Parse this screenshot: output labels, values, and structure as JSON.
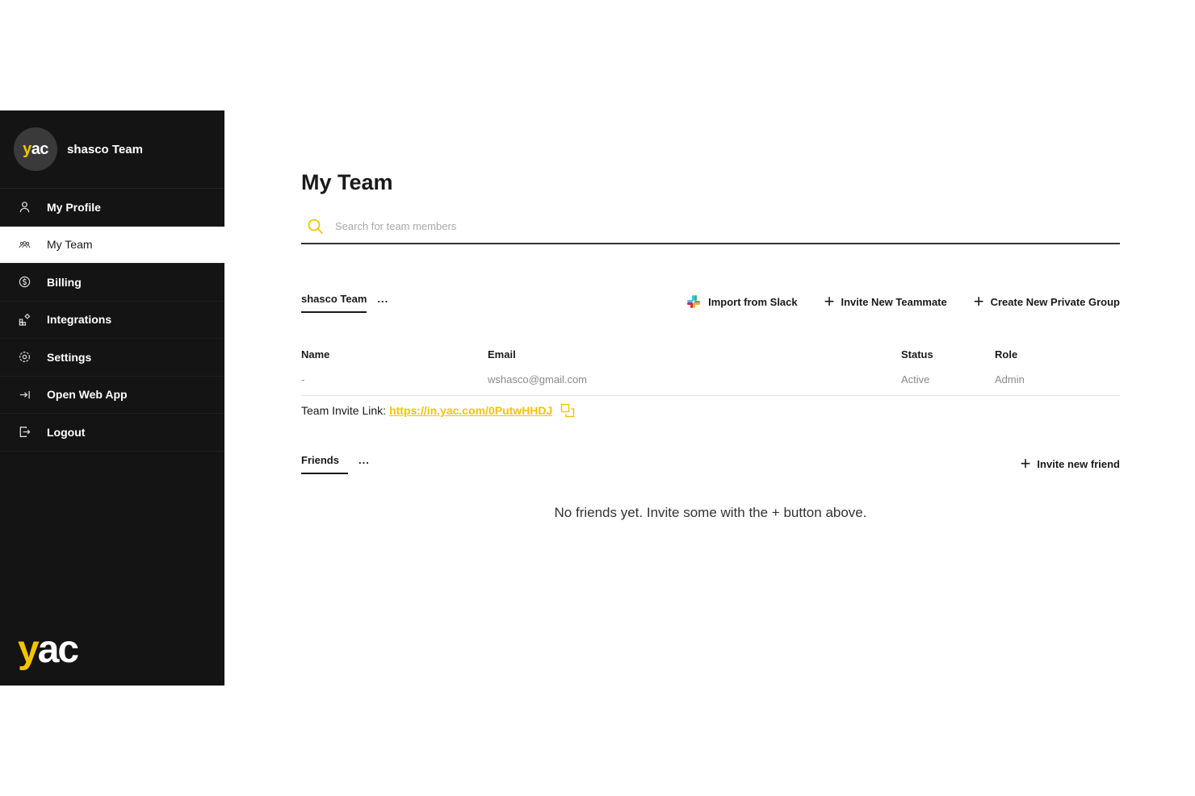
{
  "sidebar": {
    "team_avatar_text": "yac",
    "team_name": "shasco Team",
    "items": [
      {
        "label": "My Profile",
        "icon": "user-icon"
      },
      {
        "label": "My Team",
        "icon": "team-icon",
        "active": true
      },
      {
        "label": "Billing",
        "icon": "dollar-icon"
      },
      {
        "label": "Integrations",
        "icon": "integrations-icon"
      },
      {
        "label": "Settings",
        "icon": "gear-icon"
      },
      {
        "label": "Open Web App",
        "icon": "open-app-icon"
      },
      {
        "label": "Logout",
        "icon": "logout-icon"
      }
    ],
    "brand_logo": "yac"
  },
  "main": {
    "title": "My Team",
    "search": {
      "placeholder": "Search for team members",
      "icon": "search-icon"
    },
    "team_tab": {
      "label": "shasco Team",
      "more": "..."
    },
    "actions": {
      "import_slack": "Import from Slack",
      "invite_teammate": "Invite New Teammate",
      "create_group": "Create New Private Group"
    },
    "table": {
      "headers": {
        "name": "Name",
        "email": "Email",
        "status": "Status",
        "role": "Role"
      },
      "rows": [
        {
          "name": "-",
          "email": "wshasco@gmail.com",
          "status": "Active",
          "role": "Admin"
        }
      ]
    },
    "invite_link": {
      "label": "Team Invite Link:",
      "url": "https://in.yac.com/0PutwHHDJ"
    },
    "friends": {
      "tab_label": "Friends",
      "more": "...",
      "invite_label": "Invite new friend",
      "empty_text": "No friends yet. Invite some with the + button above."
    }
  },
  "colors": {
    "accent": "#f5c400",
    "sidebar_bg": "#141414",
    "text": "#1a1a1a"
  }
}
